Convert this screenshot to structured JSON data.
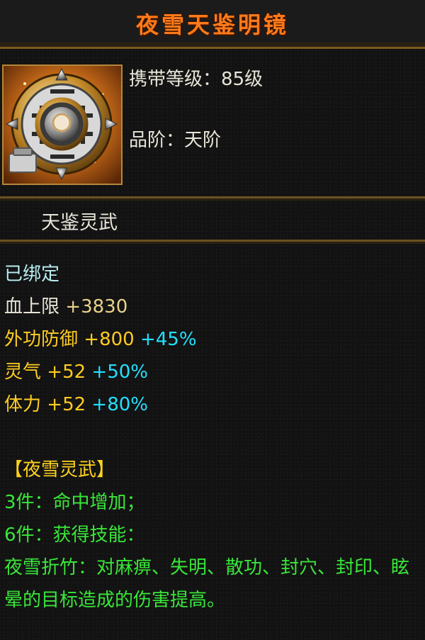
{
  "tooltip": {
    "title": "夜雪天鉴明镜",
    "level_label": "携带等级",
    "level_value": "85级",
    "grade_label": "品阶",
    "grade_value": "天阶",
    "separator": "：",
    "section_title": "天鉴灵武",
    "bound_status": "已绑定",
    "stats": [
      {
        "label": "血上限",
        "value": "+3830",
        "bonus": ""
      },
      {
        "label": "外功防御",
        "value": "+800",
        "bonus": "+45%"
      },
      {
        "label": "灵气",
        "value": "+52",
        "bonus": "+50%"
      },
      {
        "label": "体力",
        "value": "+52",
        "bonus": "+80%"
      }
    ],
    "set_name": "【夜雪灵武】",
    "set_effects": [
      "3件：命中增加；",
      "6件：获得技能："
    ],
    "skill_description": "夜雪折竹：对麻痹、失明、散功、封穴、封印、眩晕的目标造成的伤害提高。"
  },
  "colors": {
    "title": "#ff7a1a",
    "bound": "#b8eef2",
    "gold_label": "#ffcc22",
    "bonus": "#22e0ff",
    "green": "#39e639",
    "frame": "#b5873a"
  },
  "icons": {
    "item": "bronze-mirror-icon",
    "bound_lock": "lock-badge-icon"
  }
}
